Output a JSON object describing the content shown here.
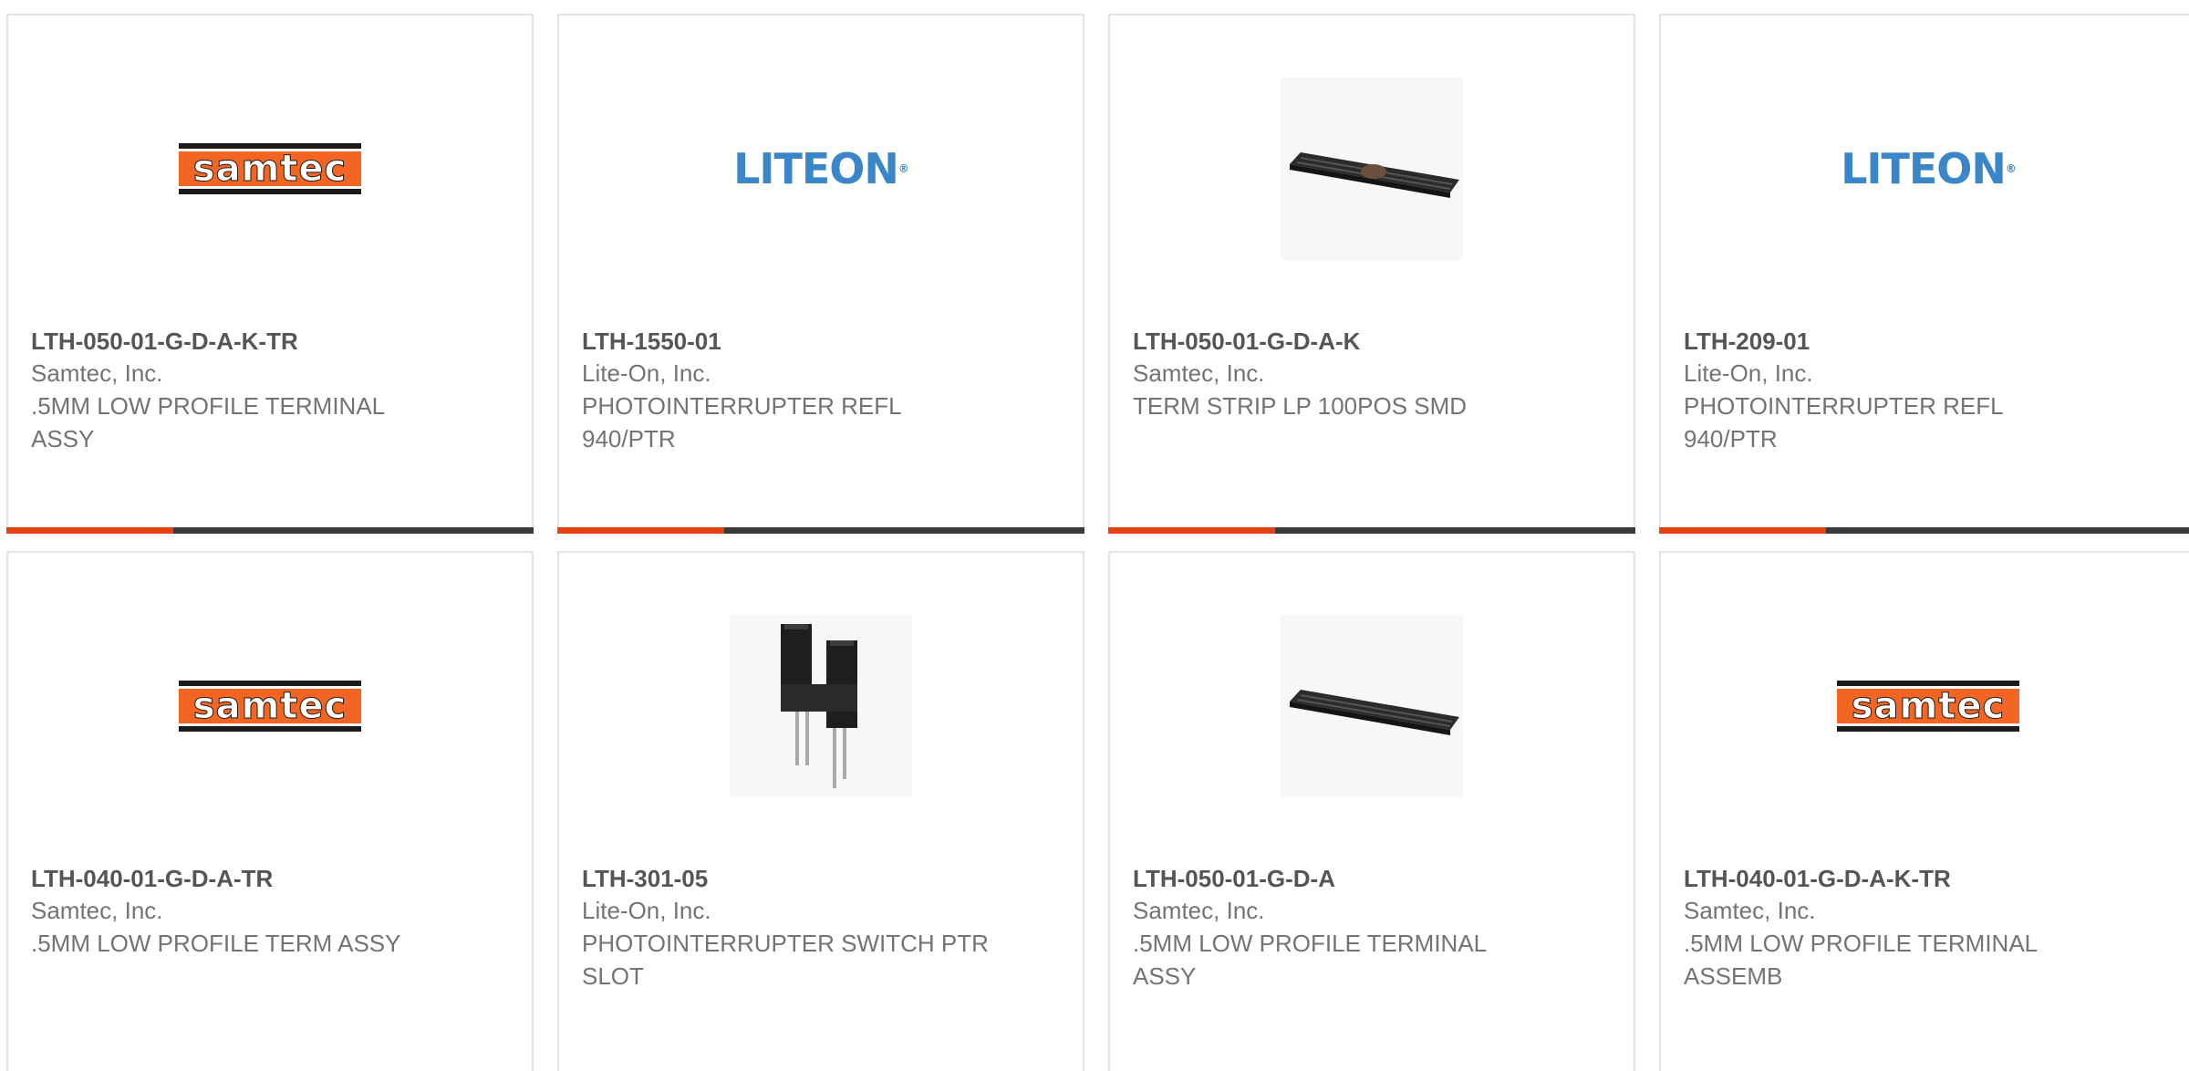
{
  "products": [
    {
      "part_number": "LTH-050-01-G-D-A-K-TR",
      "manufacturer": "Samtec, Inc.",
      "description": ".5MM LOW PROFILE TERMINAL ASSY",
      "image": "samtec-logo"
    },
    {
      "part_number": "LTH-1550-01",
      "manufacturer": "Lite-On, Inc.",
      "description": "PHOTOINTERRUPTER REFL 940/PTR",
      "image": "liteon-logo"
    },
    {
      "part_number": "LTH-050-01-G-D-A-K",
      "manufacturer": "Samtec, Inc.",
      "description": "TERM STRIP LP 100POS SMD",
      "image": "terminal-strip-photo"
    },
    {
      "part_number": "LTH-209-01",
      "manufacturer": "Lite-On, Inc.",
      "description": "PHOTOINTERRUPTER REFL 940/PTR",
      "image": "liteon-logo"
    },
    {
      "part_number": "LTH-040-01-G-D-A-TR",
      "manufacturer": "Samtec, Inc.",
      "description": ".5MM LOW PROFILE TERM ASSY",
      "image": "samtec-logo"
    },
    {
      "part_number": "LTH-301-05",
      "manufacturer": "Lite-On, Inc.",
      "description": "PHOTOINTERRUPTER SWITCH PTR SLOT",
      "image": "photointerrupter-photo"
    },
    {
      "part_number": "LTH-050-01-G-D-A",
      "manufacturer": "Samtec, Inc.",
      "description": ".5MM LOW PROFILE TERMINAL ASSY",
      "image": "terminal-strip-photo"
    },
    {
      "part_number": "LTH-040-01-G-D-A-K-TR",
      "manufacturer": "Samtec, Inc.",
      "description": ".5MM LOW PROFILE TERMINAL ASSEMB",
      "image": "samtec-logo"
    }
  ],
  "logos": {
    "samtec": "samtec",
    "liteon": "LITEON"
  },
  "colors": {
    "accent": "#e5400f",
    "bar": "#3a3a3a",
    "samtec_orange": "#f26522",
    "liteon_blue": "#3a86c8"
  }
}
